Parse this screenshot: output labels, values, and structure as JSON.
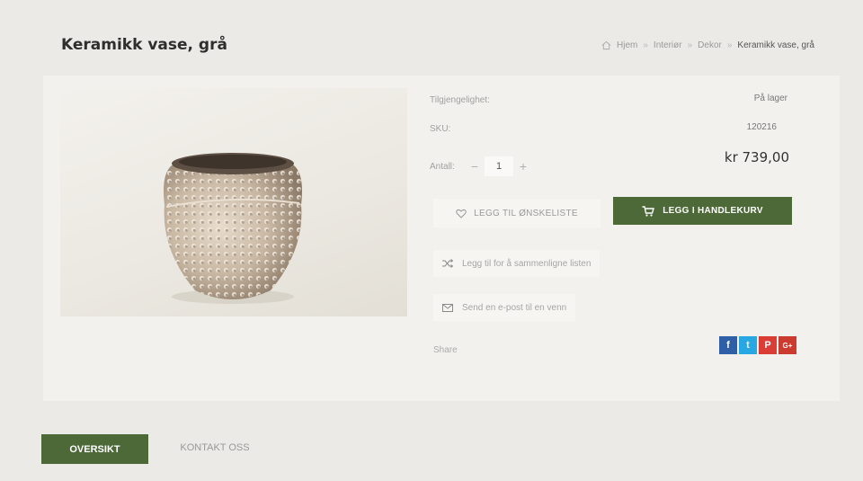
{
  "page": {
    "title": "Keramikk vase, grå"
  },
  "breadcrumb": {
    "items": [
      "Hjem",
      "Interiør",
      "Dekor"
    ],
    "current": "Keramikk vase, grå",
    "separator": "»"
  },
  "product": {
    "availability_label": "Tilgjengelighet:",
    "availability_value": "På lager",
    "sku_label": "SKU:",
    "sku_value": "120216",
    "qty_label": "Antall:",
    "qty_value": "1",
    "qty_minus": "−",
    "qty_plus": "+",
    "price": "kr 739,00"
  },
  "actions": {
    "wishlist": "LEGG TIL ØNSKELISTE",
    "add_to_cart": "LEGG I HANDLEKURV",
    "compare": "Legg til for å sammenligne listen",
    "email": "Send en e-post til en venn",
    "share": "Share"
  },
  "social": [
    {
      "name": "facebook-icon",
      "glyph": "f",
      "color": "#2f5fa7"
    },
    {
      "name": "twitter-icon",
      "glyph": "t",
      "color": "#29a7e2"
    },
    {
      "name": "pinterest-icon",
      "glyph": "P",
      "color": "#d93d35"
    },
    {
      "name": "google-plus-icon",
      "glyph": "G+",
      "color": "#cc3b2f"
    }
  ],
  "tabs": [
    {
      "label": "OVERSIKT",
      "active": true
    },
    {
      "label": "KONTAKT OSS",
      "active": false
    }
  ],
  "colors": {
    "accent": "#4d6938",
    "background": "#eceae6",
    "panel": "#f2f1ee"
  }
}
